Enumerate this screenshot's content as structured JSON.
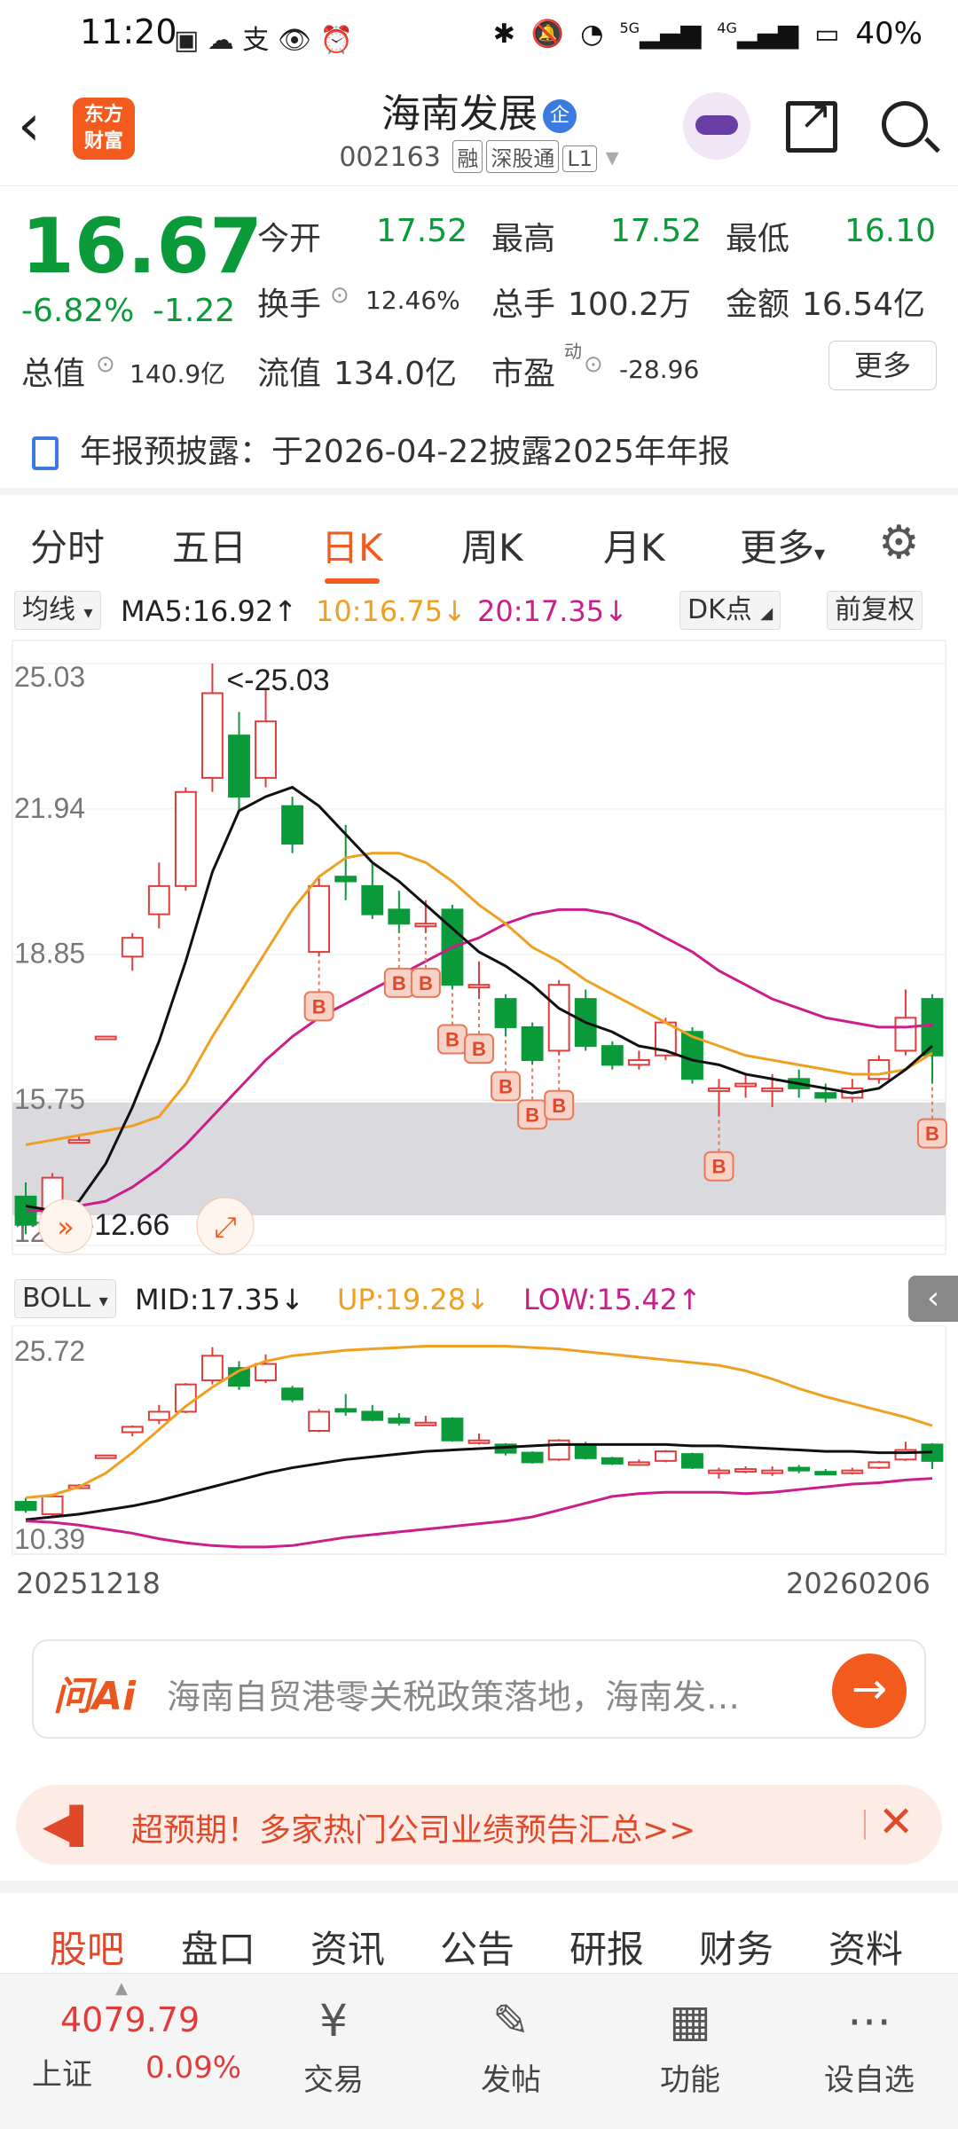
{
  "status_bar": {
    "time": "11:20",
    "battery": "40%",
    "net1": "5G",
    "net2": "4G"
  },
  "header": {
    "logo_line1": "东方",
    "logo_line2": "财富",
    "title": "海南发展",
    "badge": "企",
    "code": "002163",
    "tags": [
      "融",
      "深股通",
      "L1"
    ]
  },
  "quote": {
    "price": "16.67",
    "pct": "-6.82%",
    "chg": "-1.22",
    "open_label": "今开",
    "open": "17.52",
    "high_label": "最高",
    "high": "17.52",
    "low_label": "最低",
    "low": "16.10",
    "turnover_label": "换手",
    "turnover": "12.46%",
    "volume_label": "总手",
    "volume": "100.2万",
    "amount_label": "金额",
    "amount": "16.54亿",
    "mktcap_label": "总值",
    "mktcap": "140.9亿",
    "float_label": "流值",
    "float": "134.0亿",
    "pe_label": "市盈",
    "pe_sup": "动",
    "pe": "-28.96",
    "more": "更多"
  },
  "notice": {
    "label": "年报预披露：",
    "text": "于2026-04-22披露2025年年报"
  },
  "tabs": [
    "分时",
    "五日",
    "日K",
    "周K",
    "月K",
    "更多"
  ],
  "active_tab": "日K",
  "ma_row": {
    "selector": "均线",
    "ma5": "MA5:16.92↑",
    "ma10": "10:16.75↓",
    "ma20": "20:17.35↓",
    "dk": "DK点",
    "adj": "前复权"
  },
  "boll_row": {
    "selector": "BOLL",
    "mid": "MID:17.35↓",
    "up": "UP:19.28↓",
    "low": "LOW:15.42↑"
  },
  "colors": {
    "up": "#e03c3c",
    "down": "#0a9a3a",
    "ma5": "#111111",
    "ma10": "#f0a020",
    "ma20": "#cc1e8a",
    "accent": "#f25a1e"
  },
  "chart_data": [
    {
      "type": "candlestick",
      "title": "",
      "y_ticks": [
        "25.03",
        "21.94",
        "18.85",
        "15.75",
        "12.66"
      ],
      "ylim": [
        12.66,
        25.03
      ],
      "max_label": "<-25.03",
      "min_label": "<-12.66",
      "candles": [
        {
          "o": 13.7,
          "c": 13.1,
          "h": 14.0,
          "l": 12.9
        },
        {
          "o": 12.8,
          "c": 14.1,
          "h": 14.2,
          "l": 12.7
        },
        {
          "o": 14.9,
          "c": 14.9,
          "h": 15.0,
          "l": 14.9
        },
        {
          "o": 17.1,
          "c": 17.1,
          "h": 17.1,
          "l": 17.1
        },
        {
          "o": 18.8,
          "c": 19.2,
          "h": 19.3,
          "l": 18.5
        },
        {
          "o": 19.7,
          "c": 20.3,
          "h": 20.8,
          "l": 19.4
        },
        {
          "o": 20.3,
          "c": 22.3,
          "h": 22.4,
          "l": 20.2
        },
        {
          "o": 22.6,
          "c": 24.4,
          "h": 25.03,
          "l": 22.3
        },
        {
          "o": 23.5,
          "c": 22.2,
          "h": 24.0,
          "l": 21.9
        },
        {
          "o": 22.6,
          "c": 23.8,
          "h": 24.5,
          "l": 22.4
        },
        {
          "o": 22.0,
          "c": 21.2,
          "h": 22.2,
          "l": 21.0
        },
        {
          "o": 18.9,
          "c": 20.3,
          "h": 20.5,
          "l": 18.8
        },
        {
          "o": 20.5,
          "c": 20.4,
          "h": 21.6,
          "l": 20.0
        },
        {
          "o": 20.3,
          "c": 19.7,
          "h": 20.8,
          "l": 19.6
        },
        {
          "o": 19.8,
          "c": 19.5,
          "h": 20.2,
          "l": 19.3
        },
        {
          "o": 19.5,
          "c": 19.5,
          "h": 20.0,
          "l": 19.3
        },
        {
          "o": 19.8,
          "c": 18.2,
          "h": 19.9,
          "l": 18.1
        },
        {
          "o": 18.2,
          "c": 18.2,
          "h": 18.7,
          "l": 17.9
        },
        {
          "o": 17.9,
          "c": 17.3,
          "h": 18.0,
          "l": 17.1
        },
        {
          "o": 17.3,
          "c": 16.6,
          "h": 17.4,
          "l": 16.5
        },
        {
          "o": 16.8,
          "c": 18.2,
          "h": 18.3,
          "l": 16.7
        },
        {
          "o": 17.9,
          "c": 16.9,
          "h": 18.1,
          "l": 16.8
        },
        {
          "o": 16.9,
          "c": 16.5,
          "h": 17.0,
          "l": 16.4
        },
        {
          "o": 16.5,
          "c": 16.6,
          "h": 16.8,
          "l": 16.4
        },
        {
          "o": 16.7,
          "c": 17.4,
          "h": 17.5,
          "l": 16.6
        },
        {
          "o": 17.2,
          "c": 16.2,
          "h": 17.3,
          "l": 16.1
        },
        {
          "o": 16.0,
          "c": 16.0,
          "h": 16.2,
          "l": 15.4
        },
        {
          "o": 16.1,
          "c": 16.1,
          "h": 16.3,
          "l": 15.8
        },
        {
          "o": 16.0,
          "c": 16.0,
          "h": 16.3,
          "l": 15.6
        },
        {
          "o": 16.2,
          "c": 16.0,
          "h": 16.4,
          "l": 15.8
        },
        {
          "o": 15.9,
          "c": 15.8,
          "h": 16.1,
          "l": 15.7
        },
        {
          "o": 15.8,
          "c": 16.0,
          "h": 16.2,
          "l": 15.7
        },
        {
          "o": 16.2,
          "c": 16.6,
          "h": 16.7,
          "l": 16.1
        },
        {
          "o": 16.8,
          "c": 17.5,
          "h": 18.1,
          "l": 16.7
        },
        {
          "o": 17.9,
          "c": 16.7,
          "h": 18.0,
          "l": 16.1
        }
      ],
      "ma5": [
        13.5,
        13.4,
        13.6,
        14.4,
        15.6,
        17.0,
        18.7,
        20.6,
        21.9,
        22.2,
        22.4,
        22.0,
        21.4,
        20.8,
        20.4,
        19.9,
        19.4,
        18.9,
        18.6,
        18.2,
        17.7,
        17.4,
        17.2,
        16.9,
        16.8,
        16.6,
        16.5,
        16.3,
        16.2,
        16.1,
        16.0,
        15.9,
        16.0,
        16.4,
        16.9
      ],
      "ma10": [
        14.8,
        14.9,
        15.0,
        15.1,
        15.2,
        15.4,
        16.1,
        17.1,
        18.0,
        18.9,
        19.8,
        20.5,
        20.9,
        21.0,
        21.0,
        20.8,
        20.4,
        19.9,
        19.5,
        19.0,
        18.7,
        18.3,
        18.0,
        17.7,
        17.4,
        17.1,
        16.9,
        16.7,
        16.6,
        16.5,
        16.4,
        16.3,
        16.3,
        16.4,
        16.75
      ],
      "ma20": [
        13.4,
        13.4,
        13.5,
        13.6,
        13.9,
        14.3,
        14.8,
        15.4,
        16.0,
        16.6,
        17.1,
        17.5,
        17.8,
        18.1,
        18.4,
        18.7,
        19.0,
        19.2,
        19.5,
        19.7,
        19.8,
        19.8,
        19.7,
        19.5,
        19.2,
        18.9,
        18.5,
        18.2,
        17.9,
        17.7,
        17.5,
        17.4,
        17.3,
        17.3,
        17.35
      ],
      "buy_points": [
        11,
        14,
        15,
        16,
        17,
        18,
        19,
        20,
        26,
        34
      ],
      "band": [
        13.3,
        15.7
      ]
    },
    {
      "type": "candlestick",
      "title": "BOLL",
      "y_ticks": [
        "25.72",
        "10.39"
      ],
      "ylim": [
        10.39,
        25.72
      ],
      "up_band": [
        14.0,
        14.2,
        14.8,
        15.8,
        17.3,
        19.0,
        20.7,
        22.1,
        23.3,
        24.0,
        24.4,
        24.6,
        24.8,
        24.9,
        25.0,
        25.1,
        25.1,
        25.1,
        25.1,
        25.0,
        24.9,
        24.7,
        24.5,
        24.3,
        24.1,
        23.9,
        23.7,
        23.3,
        22.7,
        22.0,
        21.4,
        20.9,
        20.4,
        19.9,
        19.28
      ],
      "mid_band": [
        12.4,
        12.6,
        12.8,
        13.1,
        13.4,
        13.8,
        14.3,
        14.8,
        15.3,
        15.8,
        16.2,
        16.5,
        16.8,
        17.0,
        17.2,
        17.4,
        17.5,
        17.6,
        17.7,
        17.8,
        17.9,
        17.9,
        17.9,
        17.9,
        17.9,
        17.8,
        17.8,
        17.7,
        17.6,
        17.5,
        17.4,
        17.4,
        17.3,
        17.3,
        17.35
      ],
      "low_band": [
        12.3,
        12.2,
        12.0,
        11.7,
        11.4,
        11.0,
        10.7,
        10.5,
        10.4,
        10.4,
        10.5,
        10.8,
        11.1,
        11.3,
        11.5,
        11.7,
        11.9,
        12.1,
        12.3,
        12.6,
        13.1,
        13.6,
        14.1,
        14.3,
        14.4,
        14.4,
        14.4,
        14.3,
        14.4,
        14.6,
        14.8,
        15.0,
        15.1,
        15.3,
        15.42
      ],
      "x_start": "20251218",
      "x_end": "20260206"
    }
  ],
  "ai_bar": {
    "brand": "问Ai",
    "placeholder": "海南自贸港零关税政策落地，海南发…"
  },
  "banner": {
    "text": "超预期！多家热门公司业绩预告汇总>>"
  },
  "bottom_tabs": [
    "股吧",
    "盘口",
    "资讯",
    "公告",
    "研报",
    "财务",
    "资料"
  ],
  "bottom_bar": {
    "index_value": "4079.79",
    "index_name": "上证",
    "index_pct": "0.09%",
    "items": [
      {
        "label": "交易",
        "icon": "yen-circle-icon"
      },
      {
        "label": "发帖",
        "icon": "edit-icon"
      },
      {
        "label": "功能",
        "icon": "grid-icon"
      },
      {
        "label": "设自选",
        "icon": "more-circle-icon"
      }
    ]
  }
}
